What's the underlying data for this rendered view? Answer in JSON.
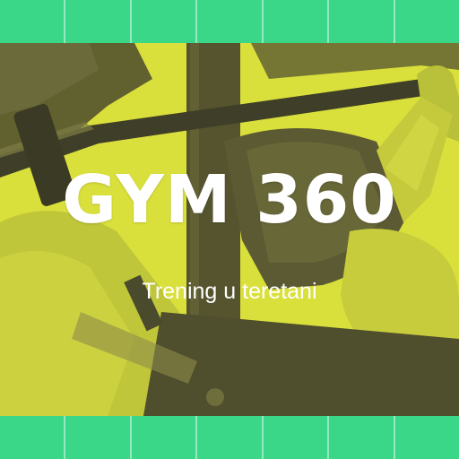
{
  "hero": {
    "title": "GYM 360",
    "subtitle": "Trening u teretani"
  },
  "colors": {
    "accent_green": "#3ad788",
    "photo_tint": "#d9df3b",
    "photo_shadow": "#4b4a2e",
    "text": "#ffffff"
  },
  "decor": {
    "tile_count": 7,
    "photo_icon": "bench-press-photo"
  }
}
